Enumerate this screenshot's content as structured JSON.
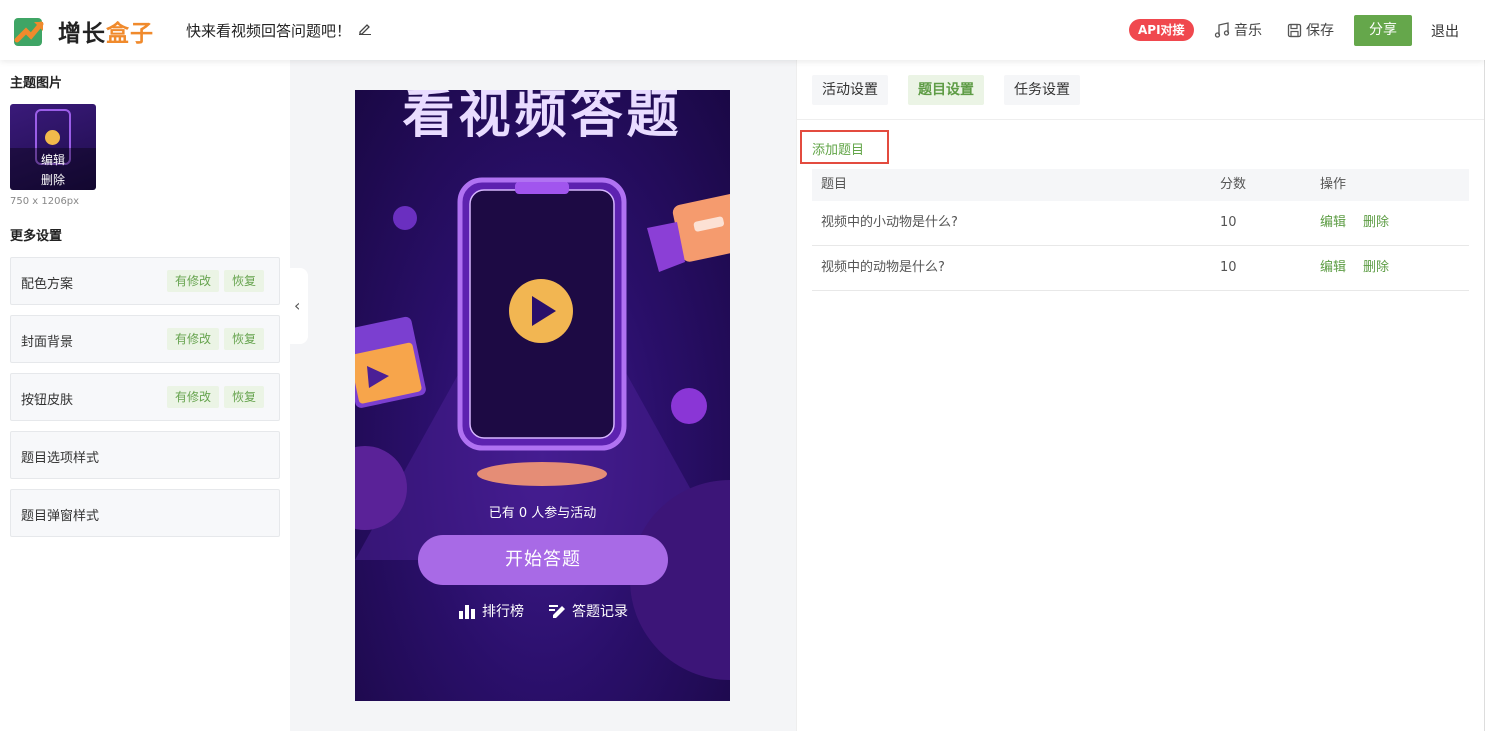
{
  "header": {
    "brand_prefix": "增长",
    "brand_suffix": "盒子",
    "title": "快来看视频回答问题吧！",
    "api_label": "API对接",
    "music_label": "音乐",
    "save_label": "保存",
    "share_label": "分享",
    "exit_label": "退出",
    "colors": {
      "share": "#65a74b",
      "api": "#f0484e",
      "brand_accent": "#f08a2c"
    }
  },
  "sidebar": {
    "theme_title": "主题图片",
    "thumb_edit": "编辑",
    "thumb_delete": "删除",
    "thumb_size": "750 x 1206px",
    "more_title": "更多设置",
    "items": [
      {
        "label": "配色方案",
        "modified": "有修改",
        "restore": "恢复"
      },
      {
        "label": "封面背景",
        "modified": "有修改",
        "restore": "恢复"
      },
      {
        "label": "按钮皮肤",
        "modified": "有修改",
        "restore": "恢复"
      },
      {
        "label": "题目选项样式"
      },
      {
        "label": "题目弹窗样式"
      }
    ]
  },
  "preview": {
    "title": "看视频答题",
    "participants": "已有 0 人参与活动",
    "start": "开始答题",
    "rank": "排行榜",
    "records": "答题记录",
    "collapse_icon": "‹"
  },
  "right": {
    "tabs": [
      "活动设置",
      "题目设置",
      "任务设置"
    ],
    "active_tab": 1,
    "add_question": "添加题目",
    "columns": [
      "题目",
      "分数",
      "操作"
    ],
    "rows": [
      {
        "question": "视频中的小动物是什么?",
        "score": "10",
        "edit": "编辑",
        "delete": "删除"
      },
      {
        "question": "视频中的动物是什么?",
        "score": "10",
        "edit": "编辑",
        "delete": "删除"
      }
    ]
  }
}
